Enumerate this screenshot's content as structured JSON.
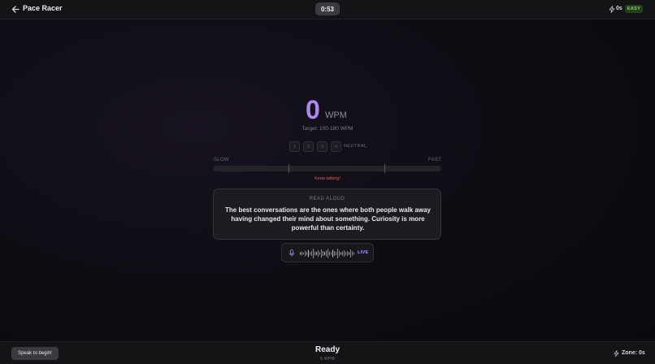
{
  "header": {
    "title": "Pace Racer",
    "back_icon": "arrow-left-icon",
    "timer": "0:53",
    "streak_icon": "lightning-icon",
    "streak": "0s",
    "difficulty": "EASY"
  },
  "speed": {
    "wpm": "0",
    "unit": "WPM",
    "target": "Target: 100-180 WPM",
    "levels": [
      "1",
      "2",
      "3",
      "4"
    ],
    "level_label": "NEUTRAL",
    "slow_label": "SLOW",
    "fast_label": "FAST",
    "hint": "Keep talking!"
  },
  "prompt": {
    "label": "READ ALOUD",
    "text": "The best conversations are the ones where both people walk away having changed their mind about something. Curiosity is more powerful than certainty."
  },
  "mic": {
    "icon": "microphone-icon",
    "live_label": "LIVE"
  },
  "footer": {
    "begin_button": "Speak to begin!",
    "status": "Ready",
    "status_sub": "0 WPM",
    "zone_icon": "lightning-icon",
    "zone": "Zone: 0s"
  },
  "colors": {
    "accent": "#a987ef",
    "difficulty_easy": "#7fd35b",
    "hint_red": "#e0585a"
  }
}
